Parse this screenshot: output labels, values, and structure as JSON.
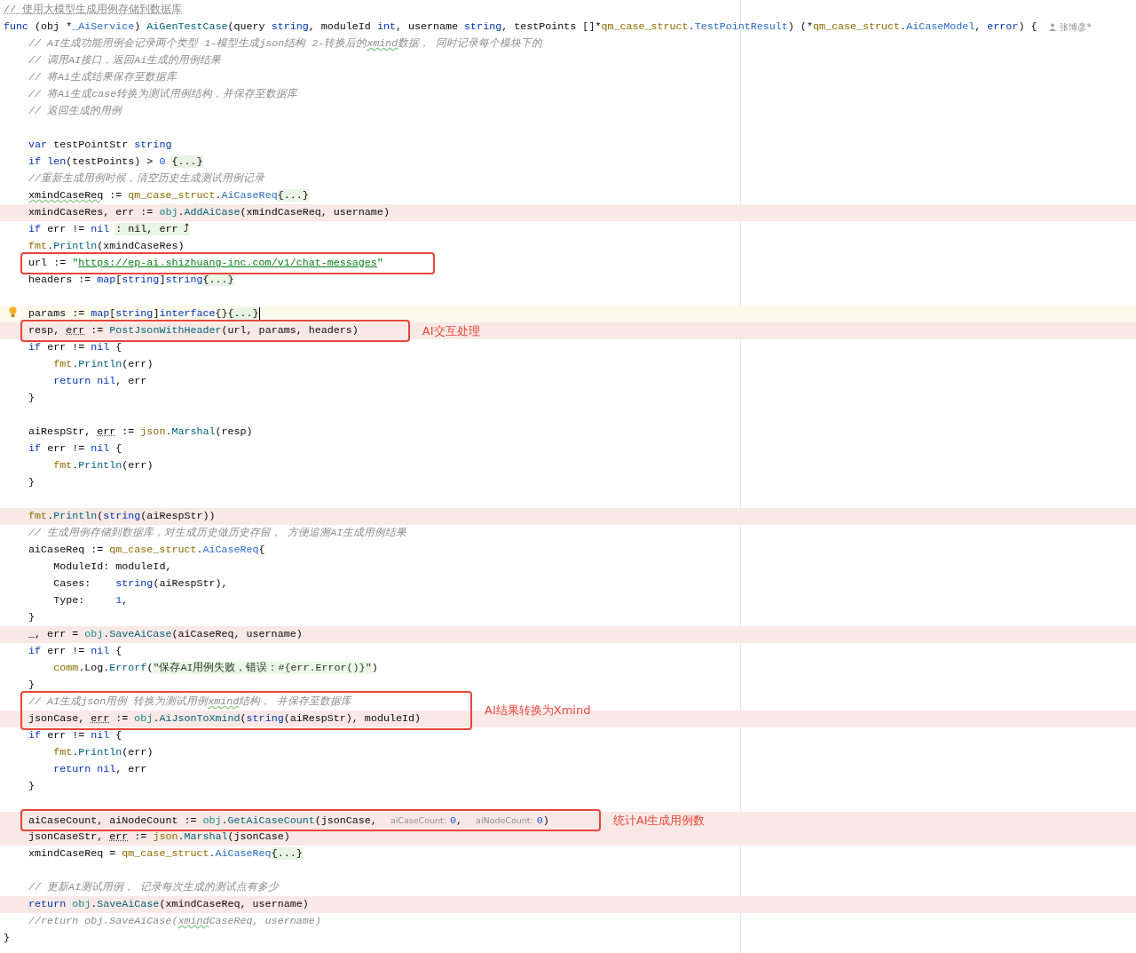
{
  "editor": {
    "lines": [
      {
        "kind": "line",
        "changed": false,
        "current": false,
        "tokens": [
          {
            "text": "// 使用大模型生成用例存储到数据库",
            "kind": "doc"
          }
        ]
      },
      {
        "kind": "line",
        "changed": false,
        "current": false,
        "author": "张博彦*",
        "tokens": [
          {
            "text": "func",
            "kind": "keyword"
          },
          {
            "text": " (obj *",
            "kind": "plain"
          },
          {
            "text": "_AiService",
            "kind": "type"
          },
          {
            "text": ") ",
            "kind": "plain"
          },
          {
            "text": "AiGenTestCase",
            "kind": "function"
          },
          {
            "text": "(query ",
            "kind": "plain"
          },
          {
            "text": "string",
            "kind": "keyword"
          },
          {
            "text": ", moduleId ",
            "kind": "plain"
          },
          {
            "text": "int",
            "kind": "keyword"
          },
          {
            "text": ", username ",
            "kind": "plain"
          },
          {
            "text": "string",
            "kind": "keyword"
          },
          {
            "text": ", testPoints []*",
            "kind": "plain"
          },
          {
            "text": "qm_case_struct",
            "kind": "package"
          },
          {
            "text": ".",
            "kind": "plain"
          },
          {
            "text": "TestPointResult",
            "kind": "type"
          },
          {
            "text": ") (*",
            "kind": "plain"
          },
          {
            "text": "qm_case_struct",
            "kind": "package"
          },
          {
            "text": ".",
            "kind": "plain"
          },
          {
            "text": "AiCaseModel",
            "kind": "type"
          },
          {
            "text": ", ",
            "kind": "plain"
          },
          {
            "text": "error",
            "kind": "keyword"
          },
          {
            "text": ") {",
            "kind": "plain"
          }
        ],
        "children": [
          {
            "kind": "line",
            "changed": false,
            "current": false,
            "tokens": [
              {
                "text": "// AI生成功能用例会记录两个类型 1-模型生成json结构 2-转换后的",
                "kind": "comment"
              },
              {
                "text": "xmind",
                "kind": "comment-typo"
              },
              {
                "text": "数据， 同时记录每个模块下的",
                "kind": "comment"
              }
            ]
          },
          {
            "kind": "line",
            "changed": false,
            "current": false,
            "tokens": [
              {
                "text": "// 调用AI接口，返回Ai生成的用例结果",
                "kind": "comment"
              }
            ]
          },
          {
            "kind": "line",
            "changed": false,
            "current": false,
            "tokens": [
              {
                "text": "// 将Ai生成结果保存至数据库",
                "kind": "comment"
              }
            ]
          },
          {
            "kind": "line",
            "changed": false,
            "current": false,
            "tokens": [
              {
                "text": "// 将Ai生成case转换为测试用例结构，并保存至数据库",
                "kind": "comment"
              }
            ]
          },
          {
            "kind": "line",
            "changed": false,
            "current": false,
            "tokens": [
              {
                "text": "// 返回生成的用例",
                "kind": "comment"
              }
            ]
          },
          {
            "kind": "blank",
            "changed": false,
            "current": false
          },
          {
            "kind": "line",
            "changed": false,
            "current": false,
            "tokens": [
              {
                "text": "var ",
                "kind": "keyword"
              },
              {
                "text": "testPointStr ",
                "kind": "plain"
              },
              {
                "text": "string",
                "kind": "keyword"
              }
            ]
          },
          {
            "kind": "line",
            "changed": false,
            "current": false,
            "tokens": [
              {
                "text": "if ",
                "kind": "keyword"
              },
              {
                "text": "len",
                "kind": "keyword"
              },
              {
                "text": "(testPoints) > ",
                "kind": "plain"
              },
              {
                "text": "0 ",
                "kind": "number"
              },
              {
                "text": "{...}",
                "kind": "folded"
              }
            ]
          },
          {
            "kind": "line",
            "changed": false,
            "current": false,
            "tokens": [
              {
                "text": "//重新生成用例时候，清空历史生成测试用例记录",
                "kind": "comment"
              }
            ]
          },
          {
            "kind": "line",
            "changed": false,
            "current": false,
            "tokens": [
              {
                "text": "xmindCaseReq",
                "kind": "typo"
              },
              {
                "text": " := ",
                "kind": "plain"
              },
              {
                "text": "qm_case_struct",
                "kind": "package"
              },
              {
                "text": ".",
                "kind": "plain"
              },
              {
                "text": "AiCaseReq",
                "kind": "type"
              },
              {
                "text": "{...}",
                "kind": "folded"
              }
            ]
          },
          {
            "kind": "line",
            "changed": true,
            "current": false,
            "tokens": [
              {
                "text": "xmindCaseRes, err := ",
                "kind": "plain"
              },
              {
                "text": "obj",
                "kind": "receiver"
              },
              {
                "text": ".",
                "kind": "plain"
              },
              {
                "text": "AddAiCase",
                "kind": "function"
              },
              {
                "text": "(xmindCaseReq, username)",
                "kind": "plain"
              }
            ]
          },
          {
            "kind": "line",
            "changed": false,
            "current": false,
            "tokens": [
              {
                "text": "if ",
                "kind": "keyword"
              },
              {
                "text": "err != ",
                "kind": "plain"
              },
              {
                "text": "nil ",
                "kind": "keyword"
              },
              {
                "text": ": nil, err ⤴",
                "kind": "folded"
              }
            ]
          },
          {
            "kind": "line",
            "changed": false,
            "current": false,
            "tokens": [
              {
                "text": "fmt",
                "kind": "package"
              },
              {
                "text": ".",
                "kind": "plain"
              },
              {
                "text": "Println",
                "kind": "function"
              },
              {
                "text": "(xmindCaseRes)",
                "kind": "plain"
              }
            ]
          },
          {
            "kind": "callout",
            "lines": [
              {
                "kind": "line",
                "changed": false,
                "current": false,
                "tokens": [
                  {
                    "text": "url := ",
                    "kind": "plain"
                  },
                  {
                    "text": "\"",
                    "kind": "string"
                  },
                  {
                    "text": "https://ep-ai.shizhuang-inc.com/v1/chat-messages",
                    "kind": "link"
                  },
                  {
                    "text": "\"",
                    "kind": "string"
                  }
                ]
              }
            ]
          },
          {
            "kind": "line",
            "changed": false,
            "current": false,
            "tokens": [
              {
                "text": "headers := ",
                "kind": "plain"
              },
              {
                "text": "map",
                "kind": "keyword"
              },
              {
                "text": "[",
                "kind": "plain"
              },
              {
                "text": "string",
                "kind": "keyword"
              },
              {
                "text": "]",
                "kind": "plain"
              },
              {
                "text": "string",
                "kind": "keyword"
              },
              {
                "text": "{...}",
                "kind": "folded"
              }
            ]
          },
          {
            "kind": "blank",
            "changed": false,
            "current": false
          },
          {
            "kind": "line",
            "changed": false,
            "current": true,
            "tokens": [
              {
                "text": "params := ",
                "kind": "plain"
              },
              {
                "text": "map",
                "kind": "keyword"
              },
              {
                "text": "[",
                "kind": "plain"
              },
              {
                "text": "string",
                "kind": "keyword"
              },
              {
                "text": "]",
                "kind": "plain"
              },
              {
                "text": "interface",
                "kind": "keyword"
              },
              {
                "text": "{}",
                "kind": "plain"
              },
              {
                "text": "{...}",
                "kind": "folded"
              }
            ]
          },
          {
            "kind": "callout",
            "label": "AI交互处理",
            "lines": [
              {
                "kind": "line",
                "changed": true,
                "current": false,
                "tokens": [
                  {
                    "text": "resp, ",
                    "kind": "plain"
                  },
                  {
                    "text": "err",
                    "kind": "shadowed"
                  },
                  {
                    "text": " := ",
                    "kind": "plain"
                  },
                  {
                    "text": "PostJsonWithHeader",
                    "kind": "function"
                  },
                  {
                    "text": "(url, params, headers)",
                    "kind": "plain"
                  }
                ]
              }
            ]
          },
          {
            "kind": "line",
            "changed": false,
            "current": false,
            "tokens": [
              {
                "text": "if ",
                "kind": "keyword"
              },
              {
                "text": "err != ",
                "kind": "plain"
              },
              {
                "text": "nil",
                "kind": "keyword"
              },
              {
                "text": " {",
                "kind": "plain"
              }
            ],
            "children": [
              {
                "kind": "line",
                "changed": false,
                "current": false,
                "tokens": [
                  {
                    "text": "fmt",
                    "kind": "package"
                  },
                  {
                    "text": ".",
                    "kind": "plain"
                  },
                  {
                    "text": "Println",
                    "kind": "function"
                  },
                  {
                    "text": "(err)",
                    "kind": "plain"
                  }
                ]
              },
              {
                "kind": "line",
                "changed": false,
                "current": false,
                "tokens": [
                  {
                    "text": "return ",
                    "kind": "keyword"
                  },
                  {
                    "text": "nil",
                    "kind": "keyword"
                  },
                  {
                    "text": ", err",
                    "kind": "plain"
                  }
                ]
              }
            ]
          },
          {
            "kind": "line",
            "changed": false,
            "current": false,
            "tokens": [
              {
                "text": "}",
                "kind": "plain"
              }
            ]
          },
          {
            "kind": "blank",
            "changed": false,
            "current": false
          },
          {
            "kind": "line",
            "changed": false,
            "current": false,
            "tokens": [
              {
                "text": "aiRespStr, ",
                "kind": "plain"
              },
              {
                "text": "err",
                "kind": "shadowed"
              },
              {
                "text": " := ",
                "kind": "plain"
              },
              {
                "text": "json",
                "kind": "package"
              },
              {
                "text": ".",
                "kind": "plain"
              },
              {
                "text": "Marshal",
                "kind": "function"
              },
              {
                "text": "(resp)",
                "kind": "plain"
              }
            ]
          },
          {
            "kind": "line",
            "changed": false,
            "current": false,
            "tokens": [
              {
                "text": "if ",
                "kind": "keyword"
              },
              {
                "text": "err != ",
                "kind": "plain"
              },
              {
                "text": "nil",
                "kind": "keyword"
              },
              {
                "text": " {",
                "kind": "plain"
              }
            ],
            "children": [
              {
                "kind": "line",
                "changed": false,
                "current": false,
                "tokens": [
                  {
                    "text": "fmt",
                    "kind": "package"
                  },
                  {
                    "text": ".",
                    "kind": "plain"
                  },
                  {
                    "text": "Println",
                    "kind": "function"
                  },
                  {
                    "text": "(err)",
                    "kind": "plain"
                  }
                ]
              }
            ]
          },
          {
            "kind": "line",
            "changed": false,
            "current": false,
            "tokens": [
              {
                "text": "}",
                "kind": "plain"
              }
            ]
          },
          {
            "kind": "blank",
            "changed": false,
            "current": false
          },
          {
            "kind": "line",
            "changed": true,
            "current": false,
            "tokens": [
              {
                "text": "fmt",
                "kind": "package"
              },
              {
                "text": ".",
                "kind": "plain"
              },
              {
                "text": "Println",
                "kind": "function"
              },
              {
                "text": "(",
                "kind": "plain"
              },
              {
                "text": "string",
                "kind": "keyword"
              },
              {
                "text": "(aiRespStr))",
                "kind": "plain"
              }
            ]
          },
          {
            "kind": "line",
            "changed": false,
            "current": false,
            "tokens": [
              {
                "text": "// 生成用例存储到数据库，对生成历史做历史存留， 方便追溯AI生成用例结果",
                "kind": "comment"
              }
            ]
          },
          {
            "kind": "line",
            "changed": false,
            "current": false,
            "tokens": [
              {
                "text": "aiCaseReq := ",
                "kind": "plain"
              },
              {
                "text": "qm_case_struct",
                "kind": "package"
              },
              {
                "text": ".",
                "kind": "plain"
              },
              {
                "text": "AiCaseReq",
                "kind": "type"
              },
              {
                "text": "{",
                "kind": "plain"
              }
            ],
            "children": [
              {
                "kind": "line",
                "changed": false,
                "current": false,
                "tokens": [
                  {
                    "text": "ModuleId: moduleId,",
                    "kind": "plain"
                  }
                ]
              },
              {
                "kind": "line",
                "changed": false,
                "current": false,
                "tokens": [
                  {
                    "text": "Cases:    ",
                    "kind": "plain"
                  },
                  {
                    "text": "string",
                    "kind": "keyword"
                  },
                  {
                    "text": "(aiRespStr),",
                    "kind": "plain"
                  }
                ]
              },
              {
                "kind": "line",
                "changed": false,
                "current": false,
                "tokens": [
                  {
                    "text": "Type:     ",
                    "kind": "plain"
                  },
                  {
                    "text": "1",
                    "kind": "number"
                  },
                  {
                    "text": ",",
                    "kind": "plain"
                  }
                ]
              }
            ]
          },
          {
            "kind": "line",
            "changed": false,
            "current": false,
            "tokens": [
              {
                "text": "}",
                "kind": "plain"
              }
            ]
          },
          {
            "kind": "line",
            "changed": true,
            "current": false,
            "tokens": [
              {
                "text": "_, err = ",
                "kind": "plain"
              },
              {
                "text": "obj",
                "kind": "receiver"
              },
              {
                "text": ".",
                "kind": "plain"
              },
              {
                "text": "SaveAiCase",
                "kind": "function"
              },
              {
                "text": "(aiCaseReq, username)",
                "kind": "plain"
              }
            ]
          },
          {
            "kind": "line",
            "changed": false,
            "current": false,
            "tokens": [
              {
                "text": "if ",
                "kind": "keyword"
              },
              {
                "text": "err != ",
                "kind": "plain"
              },
              {
                "text": "nil",
                "kind": "keyword"
              },
              {
                "text": " {",
                "kind": "plain"
              }
            ],
            "children": [
              {
                "kind": "line",
                "changed": false,
                "current": false,
                "tokens": [
                  {
                    "text": "comm",
                    "kind": "package"
                  },
                  {
                    "text": ".Log.",
                    "kind": "plain"
                  },
                  {
                    "text": "Errorf",
                    "kind": "function"
                  },
                  {
                    "text": "(",
                    "kind": "plain"
                  },
                  {
                    "text": "\"保存AI用例失败，错误：#{err.Error()}\"",
                    "kind": "injected"
                  },
                  {
                    "text": ")",
                    "kind": "plain"
                  }
                ]
              }
            ]
          },
          {
            "kind": "line",
            "changed": false,
            "current": false,
            "tokens": [
              {
                "text": "}",
                "kind": "plain"
              }
            ]
          },
          {
            "kind": "callout",
            "label": "AI结果转换为Xmind",
            "lines": [
              {
                "kind": "line",
                "changed": false,
                "current": false,
                "tokens": [
                  {
                    "text": "// AI生成json用例 转换为测试用例",
                    "kind": "comment"
                  },
                  {
                    "text": "xmind",
                    "kind": "comment-typo"
                  },
                  {
                    "text": "结构， 并保存至数据库",
                    "kind": "comment"
                  }
                ]
              },
              {
                "kind": "line",
                "changed": true,
                "current": false,
                "tokens": [
                  {
                    "text": "jsonCase, ",
                    "kind": "plain"
                  },
                  {
                    "text": "err",
                    "kind": "shadowed"
                  },
                  {
                    "text": " := ",
                    "kind": "plain"
                  },
                  {
                    "text": "obj",
                    "kind": "receiver"
                  },
                  {
                    "text": ".",
                    "kind": "plain"
                  },
                  {
                    "text": "AiJsonToXmind",
                    "kind": "function"
                  },
                  {
                    "text": "(",
                    "kind": "plain"
                  },
                  {
                    "text": "string",
                    "kind": "keyword"
                  },
                  {
                    "text": "(aiRespStr), moduleId)",
                    "kind": "plain"
                  }
                ]
              }
            ]
          },
          {
            "kind": "line",
            "changed": false,
            "current": false,
            "tokens": [
              {
                "text": "if ",
                "kind": "keyword"
              },
              {
                "text": "err != ",
                "kind": "plain"
              },
              {
                "text": "nil",
                "kind": "keyword"
              },
              {
                "text": " {",
                "kind": "plain"
              }
            ],
            "children": [
              {
                "kind": "line",
                "changed": false,
                "current": false,
                "tokens": [
                  {
                    "text": "fmt",
                    "kind": "package"
                  },
                  {
                    "text": ".",
                    "kind": "plain"
                  },
                  {
                    "text": "Println",
                    "kind": "function"
                  },
                  {
                    "text": "(err)",
                    "kind": "plain"
                  }
                ]
              },
              {
                "kind": "line",
                "changed": false,
                "current": false,
                "tokens": [
                  {
                    "text": "return ",
                    "kind": "keyword"
                  },
                  {
                    "text": "nil",
                    "kind": "keyword"
                  },
                  {
                    "text": ", err",
                    "kind": "plain"
                  }
                ]
              }
            ]
          },
          {
            "kind": "line",
            "changed": false,
            "current": false,
            "tokens": [
              {
                "text": "}",
                "kind": "plain"
              }
            ]
          },
          {
            "kind": "blank",
            "changed": false,
            "current": false
          },
          {
            "kind": "callout",
            "label": "统计AI生成用例数",
            "lines": [
              {
                "kind": "line",
                "changed": true,
                "current": false,
                "tokens": [
                  {
                    "text": "aiCaseCount, aiNodeCount := ",
                    "kind": "plain"
                  },
                  {
                    "text": "obj",
                    "kind": "receiver"
                  },
                  {
                    "text": ".",
                    "kind": "plain"
                  },
                  {
                    "text": "GetAiCaseCount",
                    "kind": "function"
                  },
                  {
                    "text": "(jsonCase, ",
                    "kind": "plain"
                  },
                  {
                    "text": "aiCaseCount:",
                    "kind": "hint"
                  },
                  {
                    "text": "0",
                    "kind": "number"
                  },
                  {
                    "text": ", ",
                    "kind": "plain"
                  },
                  {
                    "text": "aiNodeCount:",
                    "kind": "hint"
                  },
                  {
                    "text": "0",
                    "kind": "number"
                  },
                  {
                    "text": ")",
                    "kind": "plain"
                  }
                ]
              }
            ]
          },
          {
            "kind": "line",
            "changed": true,
            "current": false,
            "tokens": [
              {
                "text": "jsonCaseStr, ",
                "kind": "plain"
              },
              {
                "text": "err",
                "kind": "shadowed"
              },
              {
                "text": " := ",
                "kind": "plain"
              },
              {
                "text": "json",
                "kind": "package"
              },
              {
                "text": ".",
                "kind": "plain"
              },
              {
                "text": "Marshal",
                "kind": "function"
              },
              {
                "text": "(jsonCase)",
                "kind": "plain"
              }
            ]
          },
          {
            "kind": "line",
            "changed": false,
            "current": false,
            "tokens": [
              {
                "text": "xmindCaseReq = ",
                "kind": "plain"
              },
              {
                "text": "qm_case_struct",
                "kind": "package"
              },
              {
                "text": ".",
                "kind": "plain"
              },
              {
                "text": "AiCaseReq",
                "kind": "type"
              },
              {
                "text": "{...}",
                "kind": "folded"
              }
            ]
          },
          {
            "kind": "blank",
            "changed": false,
            "current": false
          },
          {
            "kind": "line",
            "changed": false,
            "current": false,
            "tokens": [
              {
                "text": "// 更新AI测试用例， 记录每次生成的测试点有多少",
                "kind": "comment"
              }
            ]
          },
          {
            "kind": "line",
            "changed": true,
            "current": false,
            "tokens": [
              {
                "text": "return ",
                "kind": "keyword"
              },
              {
                "text": "obj",
                "kind": "receiver"
              },
              {
                "text": ".",
                "kind": "plain"
              },
              {
                "text": "SaveAiCase",
                "kind": "function"
              },
              {
                "text": "(xmindCaseReq, username)",
                "kind": "plain"
              }
            ]
          },
          {
            "kind": "line",
            "changed": false,
            "current": false,
            "tokens": [
              {
                "text": "//return obj.SaveAiCase(",
                "kind": "comment"
              },
              {
                "text": "xmind",
                "kind": "comment-typo"
              },
              {
                "text": "CaseReq, username)",
                "kind": "comment"
              }
            ]
          }
        ]
      },
      {
        "kind": "line",
        "changed": false,
        "current": false,
        "tokens": [
          {
            "text": "}",
            "kind": "plain"
          }
        ]
      }
    ]
  }
}
